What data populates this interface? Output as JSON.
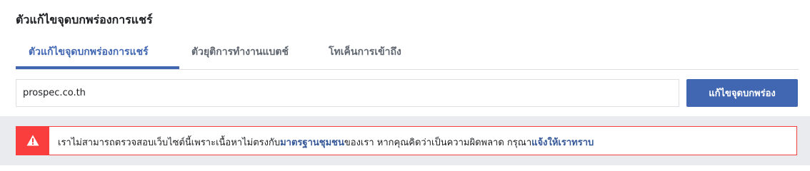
{
  "header": {
    "title": "ตัวแก้ไขจุดบกพร่องการแชร์"
  },
  "tabs": [
    {
      "label": "ตัวแก้ไขจุดบกพร่องการแชร์",
      "active": true
    },
    {
      "label": "ตัวยุติการทำงานแบตช์",
      "active": false
    },
    {
      "label": "โทเค็นการเข้าถึง",
      "active": false
    }
  ],
  "url_form": {
    "value": "prospec.co.th",
    "button_label": "แก้ไขจุดบกพร่อง"
  },
  "alert": {
    "text_1": "เราไม่สามารถตรวจสอบเว็บไซต์นี้เพราะเนื้อหาไม่ตรงกับ",
    "link_1": "มาตรฐานชุมชน",
    "text_2": "ของเรา หากคุณคิดว่าเป็นความผิดพลาด กรุณา",
    "link_2": "แจ้งให้เราทราบ",
    "icon": "warning-icon",
    "color": "#fa3e3e"
  },
  "colors": {
    "accent": "#4267b2",
    "link": "#365899",
    "error": "#fa3e3e",
    "band": "#e9ebee"
  }
}
